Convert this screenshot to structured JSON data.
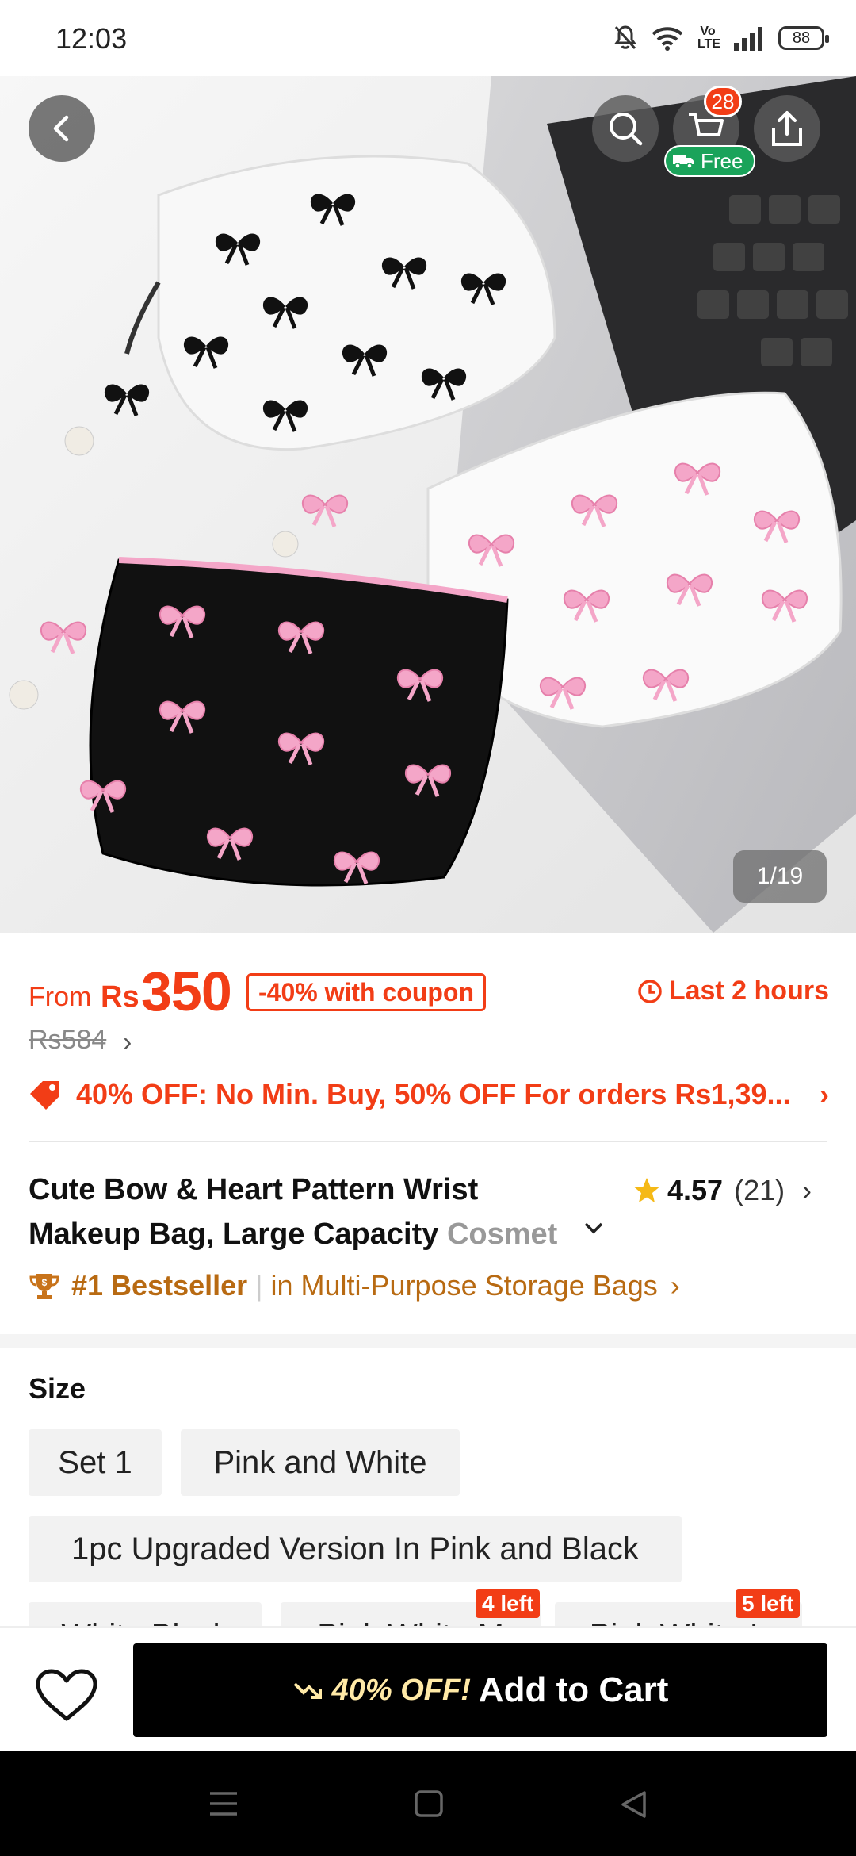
{
  "status_bar": {
    "time": "12:03",
    "battery": "88",
    "network_label": "Vo LTE",
    "icons": [
      "bell-off-icon",
      "wifi-icon",
      "volte-icon",
      "signal-icon",
      "battery-icon"
    ]
  },
  "header": {
    "cart_count": "28",
    "free_shipping_label": "Free",
    "image_counter": "1/19",
    "icons": [
      "back-icon",
      "search-icon",
      "cart-icon",
      "share-icon",
      "truck-icon"
    ]
  },
  "product_image": {
    "subject": "three bow-print quilted makeup pouches: white with black bows, white with pink bows, black with pink bows"
  },
  "price": {
    "from_label": "From",
    "currency": "Rs",
    "value": "350",
    "coupon": "-40% with coupon",
    "original": "Rs584",
    "timer": "Last 2 hours"
  },
  "promo": {
    "text": "40% OFF: No Min. Buy,  50% OFF For orders Rs1,39..."
  },
  "title": {
    "line1": "Cute Bow & Heart Pattern Wrist",
    "line2_main": "Makeup Bag, Large Capacity ",
    "line2_fade": "Cosmet"
  },
  "rating": {
    "score": "4.57",
    "count": "(21)"
  },
  "bestseller": {
    "rank": "#1 Bestseller",
    "category": "in Multi-Purpose Storage Bags"
  },
  "size": {
    "label": "Size",
    "options": [
      "Set 1",
      "Pink and White",
      "1pc Upgraded Version In Pink and Black",
      "White Black",
      "Pink White M",
      "Pink White L"
    ],
    "stock_tags": [
      "4 left",
      "5 left"
    ]
  },
  "cta": {
    "discount": "40% OFF!",
    "label": "Add to Cart"
  },
  "colors": {
    "accent": "#f23d16",
    "bestseller": "#b86a12",
    "free_badge": "#1aa35a",
    "cta_bg": "#000000"
  }
}
